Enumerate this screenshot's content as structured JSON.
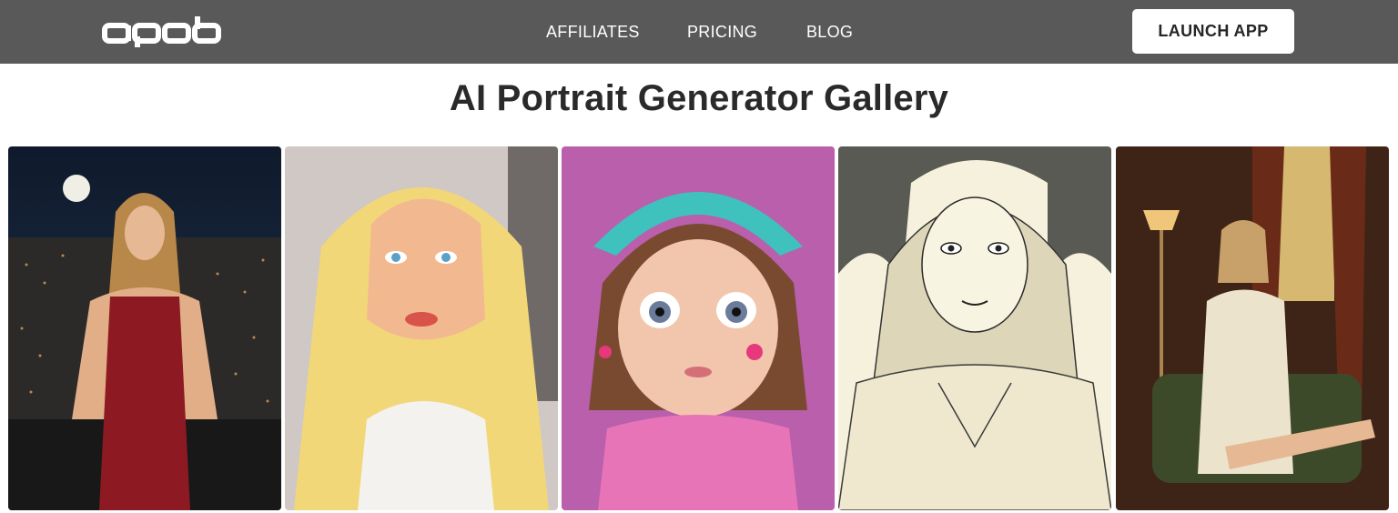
{
  "header": {
    "logo_text": "apob",
    "nav": {
      "affiliates": "AFFILIATES",
      "pricing": "PRICING",
      "blog": "BLOG"
    },
    "launch_label": "LAUNCH APP"
  },
  "page": {
    "title": "AI Portrait Generator Gallery"
  },
  "gallery": [
    {
      "subject": "night-city-portrait"
    },
    {
      "subject": "comic-blonde-portrait"
    },
    {
      "subject": "3d-cartoon-girl-portrait"
    },
    {
      "subject": "ink-sketch-portrait"
    },
    {
      "subject": "vintage-room-portrait"
    }
  ],
  "colors": {
    "header_bg": "#595959",
    "title": "#2a2a2a",
    "button_bg": "#ffffff"
  }
}
